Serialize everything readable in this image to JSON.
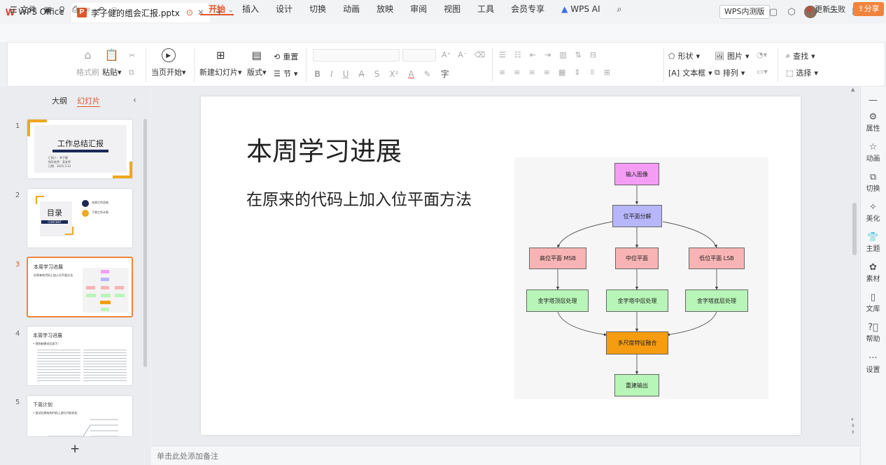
{
  "titlebar": {
    "app_name": "WPS Office",
    "doc_badge": "P",
    "doc_title": "李子健的组会汇报.pptx",
    "beta_label": "WPS内测版"
  },
  "menubar": {
    "file_label": "文件",
    "tabs": [
      "开始",
      "插入",
      "设计",
      "切换",
      "动画",
      "放映",
      "审阅",
      "视图",
      "工具",
      "会员专享",
      "WPS AI"
    ],
    "active_tab": "开始",
    "renew_label": "更新失败",
    "share_label": "分享"
  },
  "ribbon": {
    "format_painter": "格式刷",
    "paste": "粘贴",
    "play_from_current": "当页开始",
    "new_slide": "新建幻灯片",
    "layout": "版式",
    "reset": "重置",
    "section": "节",
    "shape": "形状",
    "picture": "图片",
    "textbox": "文本框",
    "arrange": "排列",
    "find": "查找",
    "select": "选择"
  },
  "leftpanel": {
    "tabs": [
      "大纲",
      "幻灯片"
    ],
    "active_tab": "幻灯片",
    "thumbs": [
      {
        "num": "1",
        "title": "工作总结汇报",
        "lines": [
          "汇报人：李子健",
          "指导老师：某老师",
          "日期：2025.5.21"
        ]
      },
      {
        "num": "2",
        "title": "目录",
        "band": "CONTENT",
        "items": [
          "本周工作总结",
          "下周工作计划"
        ]
      },
      {
        "num": "3",
        "title": "本周学习进展",
        "line": "在原来的代码上加入位平面方法"
      },
      {
        "num": "4",
        "title": "本周学习进展",
        "line": "• 得到结果对比如下："
      },
      {
        "num": "5",
        "title": "下周计划",
        "line": "• 尝试在原有的代码上进行代码优化"
      }
    ],
    "add_label": "+"
  },
  "slide": {
    "title": "本周学习进展",
    "body": "在原来的代码上加入位平面方法"
  },
  "flowchart": {
    "nodes": {
      "input": "输入图像",
      "decompose": "位平面分解",
      "msb": "高位平面 MSB",
      "mid": "中位平面",
      "lsb": "低位平面 LSB",
      "top": "金字塔顶层处理",
      "middle": "金字塔中层处理",
      "bottom": "金字塔底层处理",
      "fusion": "多尺度特征融合",
      "output": "重建输出"
    },
    "colors": {
      "input": "#f59cf5",
      "decompose": "#b7b6fb",
      "planes": "#f8b4b4",
      "pyramid": "#b8f5b8",
      "fusion": "#f59c10",
      "output": "#b8f5b8",
      "background": "#f6f6f6"
    }
  },
  "notes": {
    "placeholder": "单击此处添加备注"
  },
  "rightrail": {
    "items": [
      "属性",
      "动画",
      "切换",
      "美化",
      "主题",
      "素材",
      "文库",
      "帮助",
      "设置"
    ]
  },
  "colors": {
    "accent": "#e0562a",
    "share": "#f0843c"
  }
}
